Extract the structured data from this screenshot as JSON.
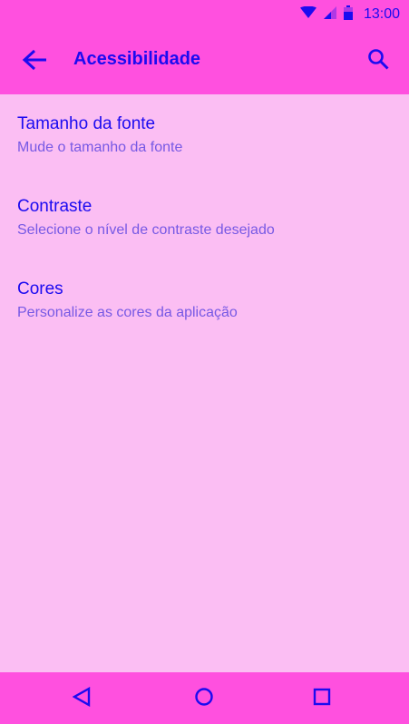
{
  "status_bar": {
    "time": "13:00",
    "icons": [
      "wifi-icon",
      "cellular-signal-icon",
      "battery-icon"
    ]
  },
  "app_bar": {
    "title": "Acessibilidade",
    "back_icon": "arrow-back-icon",
    "search_icon": "search-icon"
  },
  "settings": {
    "items": [
      {
        "title": "Tamanho da fonte",
        "subtitle": "Mude o tamanho da fonte"
      },
      {
        "title": "Contraste",
        "subtitle": "Selecione o nível de contraste desejado"
      },
      {
        "title": "Cores",
        "subtitle": "Personalize as cores da aplicação"
      }
    ]
  },
  "nav_bar": {
    "icons": [
      "back-triangle-icon",
      "home-circle-icon",
      "recents-square-icon"
    ]
  },
  "colors": {
    "bar_background": "#FF50DF",
    "page_background": "#FBBEF3",
    "primary_text": "#1C0BF0",
    "secondary_text": "#7759E4"
  }
}
